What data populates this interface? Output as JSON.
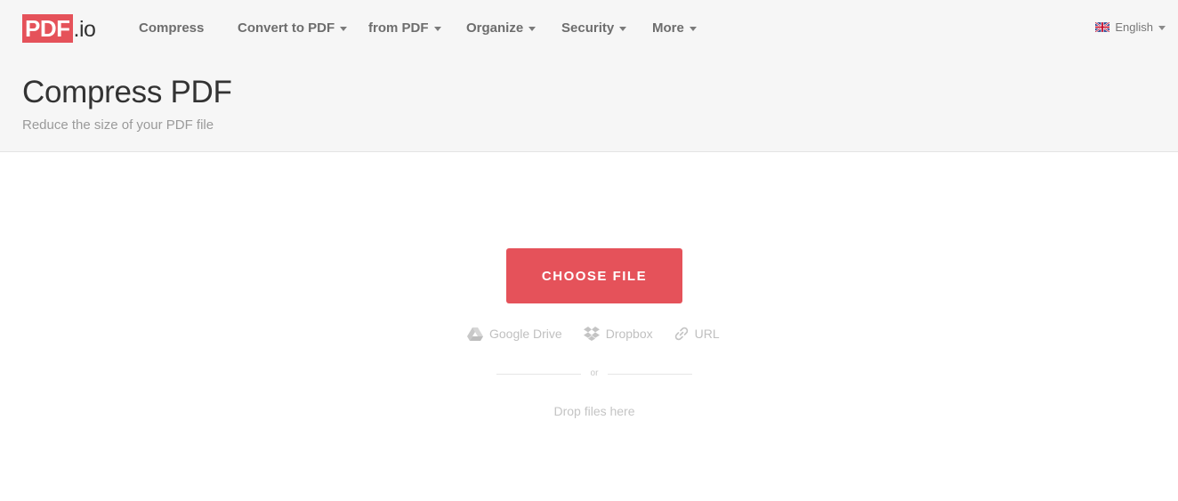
{
  "logo": {
    "brand": "PDF",
    "suffix": ".io"
  },
  "nav": {
    "items": [
      {
        "label": "Compress",
        "dropdown": false
      },
      {
        "label": "Convert to PDF",
        "dropdown": true
      },
      {
        "label": "from PDF",
        "dropdown": true
      },
      {
        "label": "Organize",
        "dropdown": true
      },
      {
        "label": "Security",
        "dropdown": true
      },
      {
        "label": "More",
        "dropdown": true
      }
    ],
    "language": {
      "label": "English",
      "flag": "uk-flag-icon"
    }
  },
  "header": {
    "title": "Compress PDF",
    "subtitle": "Reduce the size of your PDF file"
  },
  "upload": {
    "choose_label": "CHOOSE FILE",
    "sources": [
      {
        "label": "Google Drive",
        "icon": "google-drive-icon"
      },
      {
        "label": "Dropbox",
        "icon": "dropbox-icon"
      },
      {
        "label": "URL",
        "icon": "link-icon"
      }
    ],
    "or_label": "or",
    "drop_label": "Drop files here"
  },
  "colors": {
    "accent": "#e5525a",
    "header_bg": "#f6f6f6"
  }
}
